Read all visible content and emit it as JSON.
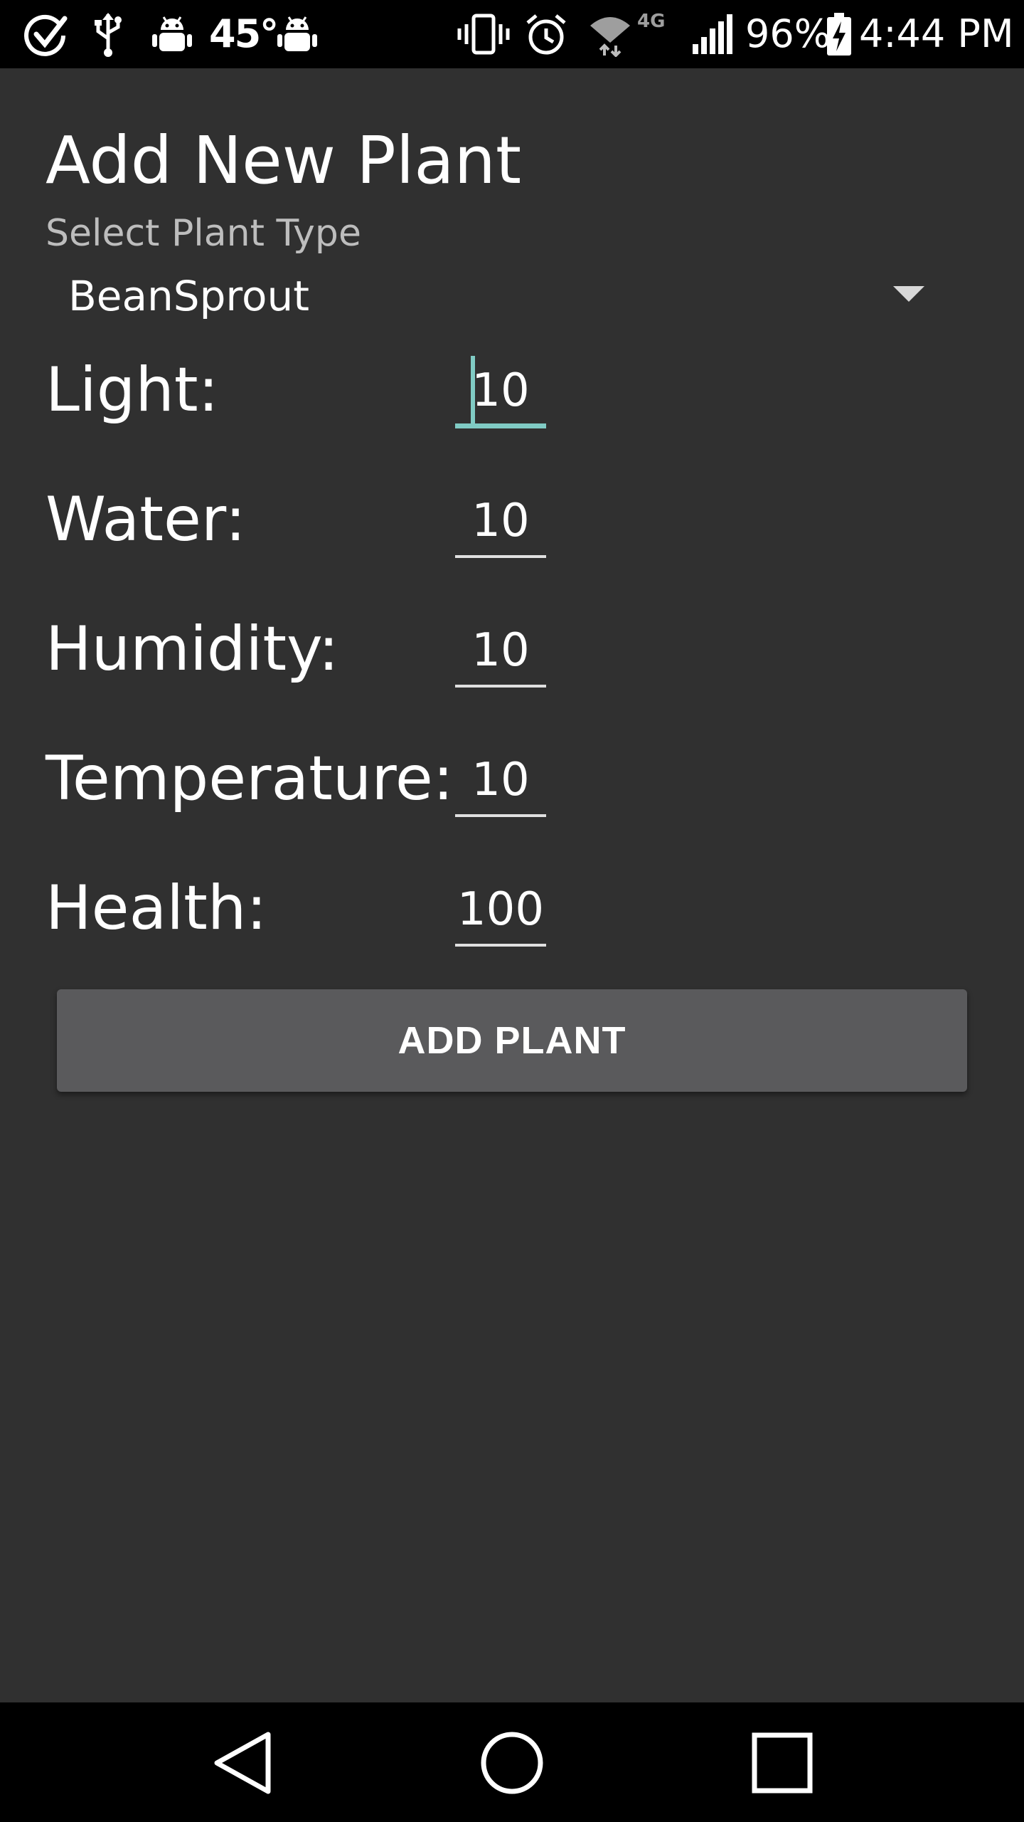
{
  "status_bar": {
    "temperature": "45°",
    "battery_percent": "96%",
    "time": "4:44 PM",
    "network_type": "4G",
    "icons_left": [
      "check-circle-icon",
      "usb-icon",
      "android-debug-icon",
      "android-debug-icon"
    ],
    "icons_right": [
      "vibrate-icon",
      "alarm-icon",
      "wifi-icon",
      "cell-signal-icon",
      "battery-charging-icon"
    ]
  },
  "form": {
    "title": "Add New Plant",
    "plant_type_label": "Select Plant Type",
    "plant_type_value": "BeanSprout",
    "fields": [
      {
        "label": "Light:",
        "value": "10",
        "focused": true
      },
      {
        "label": "Water:",
        "value": "10"
      },
      {
        "label": "Humidity:",
        "value": "10"
      },
      {
        "label": "Temperature:",
        "value": "10"
      },
      {
        "label": "Health:",
        "value": "100"
      }
    ],
    "submit_label": "ADD PLANT"
  },
  "nav_bar": {
    "buttons": [
      "back-icon",
      "home-icon",
      "recents-icon"
    ]
  },
  "colors": {
    "background": "#303030",
    "accent": "#80cbc4",
    "button": "#5a5a5c"
  }
}
